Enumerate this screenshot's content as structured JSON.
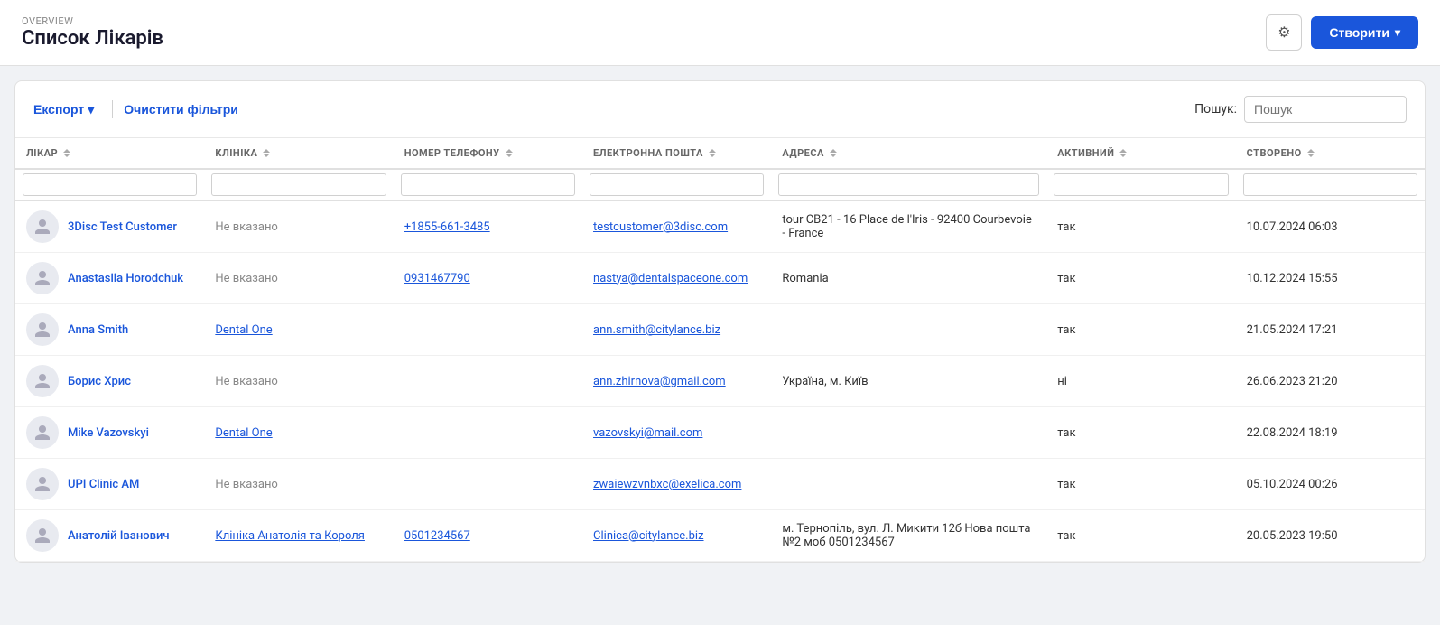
{
  "header": {
    "overview_label": "OVERVIEW",
    "page_title": "Список Лікарів",
    "gear_icon": "⚙",
    "create_button_label": "Створити",
    "create_chevron": "▾"
  },
  "toolbar": {
    "export_label": "Експорт",
    "export_chevron": "▾",
    "clear_filters_label": "Очистити фільтри",
    "search_label": "Пошук:",
    "search_placeholder": "Пошук"
  },
  "table": {
    "columns": [
      {
        "key": "doctor",
        "label": "ЛІКАР"
      },
      {
        "key": "clinic",
        "label": "КЛІНІКА"
      },
      {
        "key": "phone",
        "label": "НОМЕР ТЕЛЕФОНУ"
      },
      {
        "key": "email",
        "label": "ЕЛЕКТРОННА ПОШТА"
      },
      {
        "key": "address",
        "label": "АДРЕСА"
      },
      {
        "key": "active",
        "label": "АКТИВНИЙ"
      },
      {
        "key": "created",
        "label": "СТВОРЕНО"
      }
    ],
    "rows": [
      {
        "doctor": "3Disc Test Customer",
        "clinic": "Не вказано",
        "phone": "+1855-661-3485",
        "email": "testcustomer@3disc.com",
        "address": "tour CB21 - 16 Place de l'Iris - 92400 Courbevoie - France",
        "active": "так",
        "created": "10.07.2024 06:03"
      },
      {
        "doctor": "Anastasiia Horodchuk",
        "clinic": "Не вказано",
        "phone": "0931467790",
        "email": "nastya@dentalspaceone.com",
        "address": "Romania",
        "active": "так",
        "created": "10.12.2024 15:55"
      },
      {
        "doctor": "Anna Smith",
        "clinic": "Dental One",
        "phone": "",
        "email": "ann.smith@citylance.biz",
        "address": "",
        "active": "так",
        "created": "21.05.2024 17:21"
      },
      {
        "doctor": "Борис Хрис",
        "clinic": "Не вказано",
        "phone": "",
        "email": "ann.zhirnova@gmail.com",
        "address": "Україна, м. Київ",
        "active": "ні",
        "created": "26.06.2023 21:20"
      },
      {
        "doctor": "Mike Vazovskyi",
        "clinic": "Dental One",
        "phone": "",
        "email": "vazovskyi@mail.com",
        "address": "",
        "active": "так",
        "created": "22.08.2024 18:19"
      },
      {
        "doctor": "UPI Clinic AM",
        "clinic": "Не вказано",
        "phone": "",
        "email": "zwaiewzvnbxc@exelica.com",
        "address": "",
        "active": "так",
        "created": "05.10.2024 00:26"
      },
      {
        "doctor": "Анатолій Іванович",
        "clinic": "Клініка Анатолія та Короля",
        "phone": "0501234567",
        "email": "Clinica@citylance.biz",
        "address": "м. Тернопіль, вул. Л. Микити 12б Нова пошта №2 моб 0501234567",
        "active": "так",
        "created": "20.05.2023 19:50"
      }
    ]
  }
}
